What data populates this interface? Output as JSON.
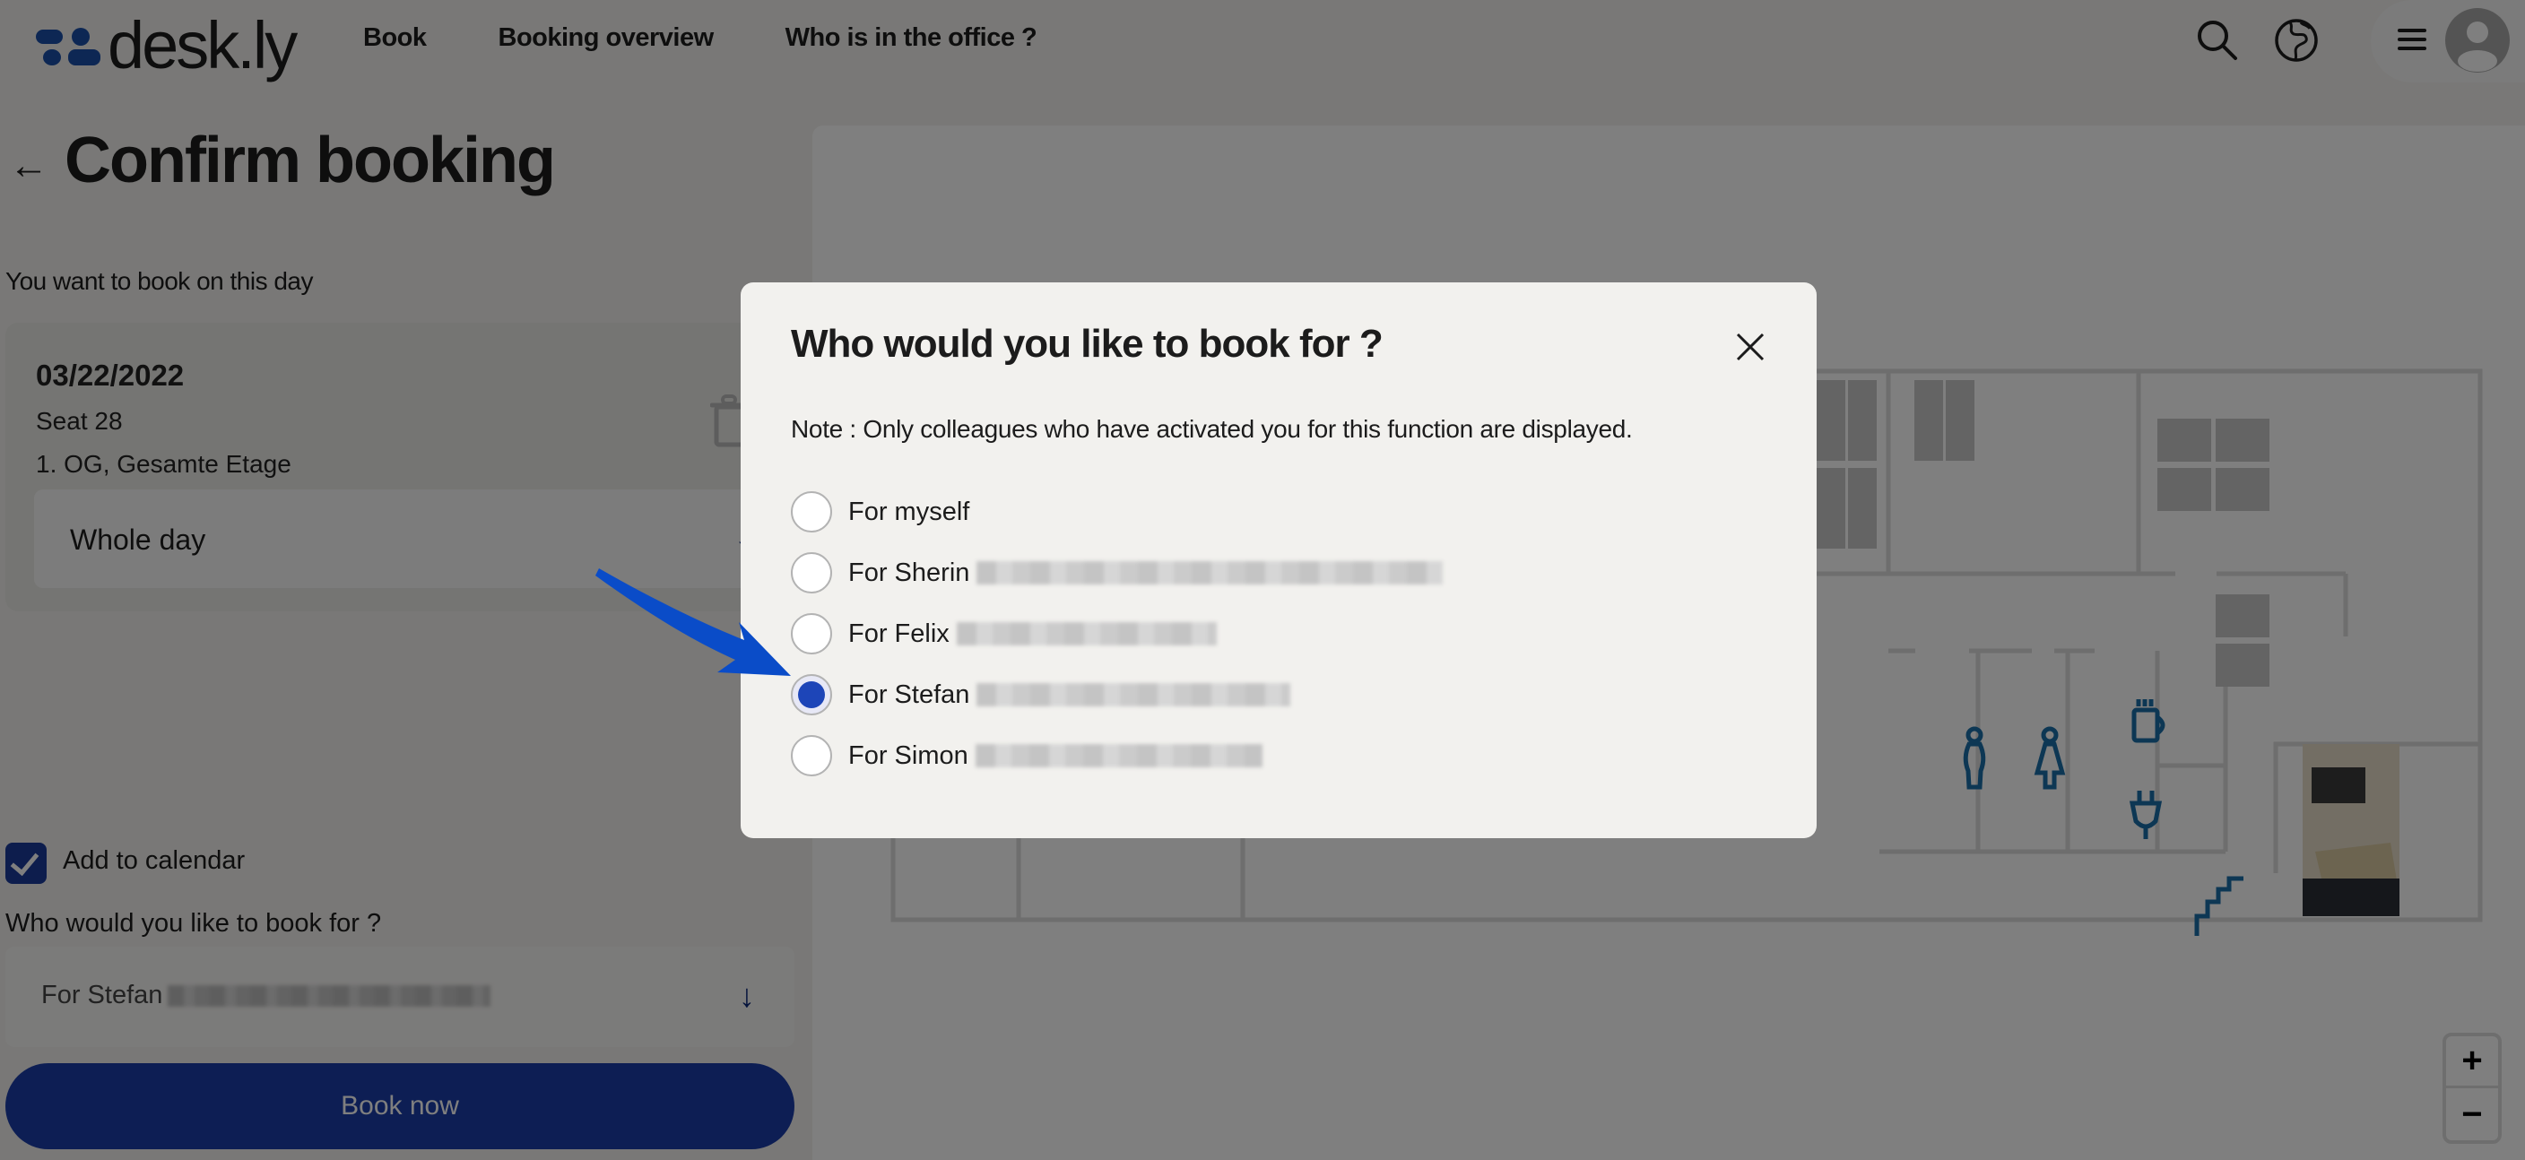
{
  "header": {
    "logo_text": "desk.ly",
    "nav": [
      "Book",
      "Booking overview",
      "Who is in the office ?"
    ],
    "icons": [
      "search-icon",
      "globe-icon",
      "menu-icon",
      "avatar-icon"
    ]
  },
  "page": {
    "back_icon": "←",
    "title": "Confirm booking",
    "day_label": "You want to book on this day",
    "booking": {
      "date": "03/22/2022",
      "seat": "Seat 28",
      "location": "1. OG, Gesamte Etage",
      "time_option": "Whole day",
      "dropdown_icon": "↓"
    },
    "add_to_calendar": {
      "label": "Add to calendar",
      "checked": true
    },
    "who_label": "Who would you like to book for ?",
    "who_selected": "For Stefan",
    "book_button": "Book now"
  },
  "map": {
    "zoom_in": "+",
    "zoom_out": "−",
    "accent_color": "#1a6fa8",
    "amenity_icons": [
      "male-restroom-icon",
      "female-restroom-icon",
      "coffee-icon",
      "power-plug-icon",
      "stairs-icon"
    ]
  },
  "modal": {
    "title": "Who would you like to book for ?",
    "note": "Note : Only colleagues who have activated you for this function are displayed.",
    "options": [
      {
        "label": "For myself",
        "selected": false,
        "redacted": false
      },
      {
        "label": "For Sherin",
        "selected": false,
        "redacted": true
      },
      {
        "label": "For Felix",
        "selected": false,
        "redacted": true
      },
      {
        "label": "For Stefan",
        "selected": true,
        "redacted": true
      },
      {
        "label": "For Simon",
        "selected": false,
        "redacted": true
      }
    ]
  },
  "colors": {
    "brand_blue": "#1a3da8",
    "radio_selected": "#1d45b8",
    "annotation_arrow": "#0a4cc8"
  }
}
